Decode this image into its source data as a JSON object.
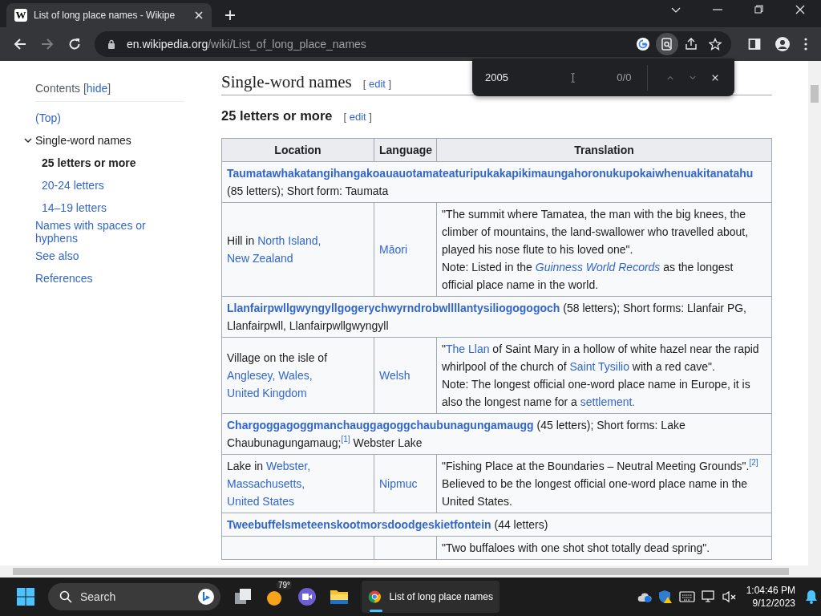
{
  "browser": {
    "tab_icon_letter": "W",
    "tab_title": "List of long place names - Wikipe",
    "url_host": "en.wikipedia.org",
    "url_path": "/wiki/List_of_long_place_names",
    "forward_disabled": true
  },
  "find_bar": {
    "value": "2005",
    "count": "0/0"
  },
  "sidebar": {
    "header": [
      {
        "kind": "text",
        "text": "Contents ["
      },
      {
        "kind": "link",
        "text": "hide"
      },
      {
        "kind": "text",
        "text": "]"
      }
    ],
    "items": [
      {
        "label": "(Top)",
        "selected": false
      },
      {
        "label": "Single-word names",
        "selected": false,
        "expanded": true,
        "children": [
          {
            "label": "25 letters or more",
            "selected": true
          },
          {
            "label": "20-24 letters",
            "selected": false
          },
          {
            "label": "14–19 letters",
            "selected": false
          }
        ]
      },
      {
        "label": "Names with spaces or hyphens",
        "selected": false
      },
      {
        "label": "See also",
        "selected": false
      },
      {
        "label": "References",
        "selected": false
      }
    ]
  },
  "article": {
    "heading": "Single-word names",
    "heading_edit": [
      {
        "kind": "text",
        "text": "[ "
      },
      {
        "kind": "link",
        "text": "edit"
      },
      {
        "kind": "text",
        "text": " ]"
      }
    ],
    "subheading": "25 letters or more",
    "subheading_edit": [
      {
        "kind": "text",
        "text": "[ "
      },
      {
        "kind": "link",
        "text": "edit"
      },
      {
        "kind": "text",
        "text": " ]"
      }
    ],
    "table": {
      "columns": [
        "Location",
        "Language",
        "Translation"
      ],
      "rows": [
        {
          "kind": "name",
          "lines": [
            [
              {
                "kind": "title_link",
                "text": "Taumatawhakatangihangakoauauotamateaturipukakapikimaungahoronukupokaiwhenuakitanatahu"
              },
              {
                "kind": "text",
                "text": " (85 letters); Short form: Taumata"
              }
            ]
          ]
        },
        {
          "kind": "detail",
          "location": [
            [
              {
                "kind": "text",
                "text": "Hill in "
              },
              {
                "kind": "link",
                "text": "North Island,"
              },
              {
                "kind": "link",
                "text": "New Zealand"
              }
            ]
          ],
          "language": [
            [
              {
                "kind": "link",
                "text": "Māori"
              }
            ]
          ],
          "translation": [
            [
              {
                "kind": "text",
                "text": "\"The summit where Tamatea, the man with the big knees, the climber of mountains, the land-swallower who travelled about, played his nose flute to his loved one\"."
              }
            ],
            [
              {
                "kind": "text",
                "text": "Note: Listed in the "
              },
              {
                "kind": "italic_link",
                "text": "Guinness World Records"
              },
              {
                "kind": "text",
                "text": " as the longest official place name in the world."
              }
            ]
          ]
        },
        {
          "kind": "name",
          "lines": [
            [
              {
                "kind": "title_link",
                "text": "Llanfairpwllgwyngyllgogerychwyrndrobwllllantysiliogogogoch"
              },
              {
                "kind": "text",
                "text": " (58 letters); Short forms: Llanfair PG, Llanfairpwll, Llanfairpwllgwyngyll"
              }
            ]
          ]
        },
        {
          "kind": "detail",
          "location": [
            [
              {
                "kind": "text",
                "text": "Village on the isle of "
              },
              {
                "kind": "link",
                "text": "Anglesey,"
              },
              {
                "kind": "link",
                "text": "Wales,"
              },
              {
                "kind": "link",
                "text": "United Kingdom"
              }
            ]
          ],
          "language": [
            [
              {
                "kind": "link",
                "text": "Welsh"
              }
            ]
          ],
          "translation": [
            [
              {
                "kind": "text",
                "text": "\""
              },
              {
                "kind": "link",
                "text": "The Llan"
              },
              {
                "kind": "text",
                "text": " of Saint Mary in a hollow of white hazel near the rapid whirlpool of the church of "
              },
              {
                "kind": "link",
                "text": "Saint Tysilio"
              },
              {
                "kind": "text",
                "text": " with a red cave\"."
              }
            ],
            [
              {
                "kind": "text",
                "text": "Note: The longest official one-word place name in Europe, it is also the longest name for a "
              },
              {
                "kind": "link",
                "text": "settlement."
              }
            ]
          ]
        },
        {
          "kind": "name",
          "lines": [
            [
              {
                "kind": "title_link",
                "text": "Chargoggagoggmanchauggagoggchaubunagungamaugg"
              },
              {
                "kind": "text",
                "text": " (45 letters); Short forms: Lake Chaubunagungamaug;"
              },
              {
                "kind": "ref",
                "text": "[1]"
              },
              {
                "kind": "text",
                "text": " Webster Lake"
              }
            ]
          ]
        },
        {
          "kind": "detail",
          "location": [
            [
              {
                "kind": "text",
                "text": "Lake in "
              },
              {
                "kind": "link",
                "text": "Webster,"
              },
              {
                "kind": "link",
                "text": "Massachusetts,"
              },
              {
                "kind": "link",
                "text": "United States"
              }
            ]
          ],
          "language": [
            [
              {
                "kind": "link",
                "text": "Nipmuc"
              }
            ]
          ],
          "translation": [
            [
              {
                "kind": "text",
                "text": "\"Fishing Place at the Boundaries – Neutral Meeting Grounds\"."
              },
              {
                "kind": "ref",
                "text": "[2]"
              },
              {
                "kind": "text",
                "text": " Believed to be the longest official one-word place name in the United States."
              }
            ]
          ]
        },
        {
          "kind": "name",
          "lines": [
            [
              {
                "kind": "title_link",
                "text": "Tweebuffelsmeteenskootmorsdoodgeskietfontein"
              },
              {
                "kind": "text",
                "text": " (44 letters)"
              }
            ]
          ]
        },
        {
          "kind": "detail",
          "translation": [
            [
              {
                "kind": "text",
                "text": "\"Two buffaloes with one shot shot totally dead spring\"."
              }
            ]
          ]
        }
      ]
    }
  },
  "taskbar": {
    "search_placeholder": "Search",
    "weather": "79°",
    "app_title": "List of long place names",
    "time": "1:04:46 PM",
    "date": "9/12/2023"
  }
}
